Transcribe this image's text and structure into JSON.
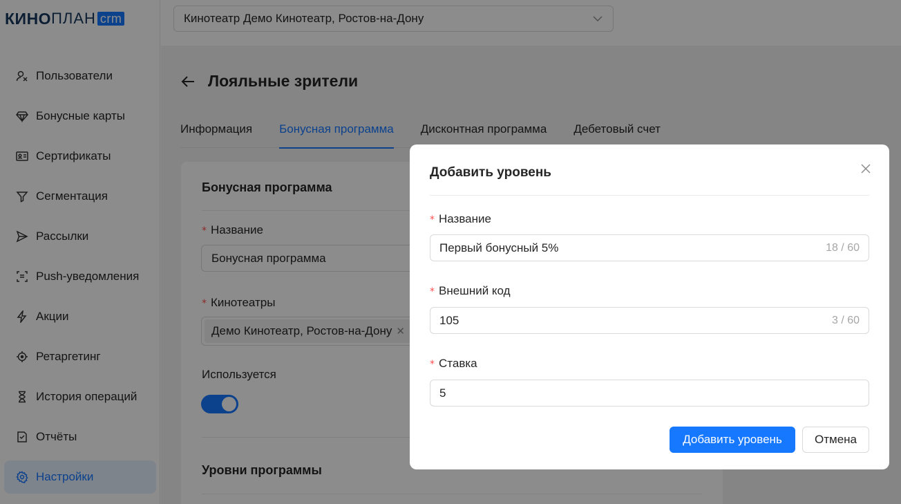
{
  "logo": {
    "main": "КИНО",
    "sub": "ПЛАН",
    "badge": "crm"
  },
  "sidebar": {
    "items": [
      {
        "label": "Пользователи",
        "icon": "users-icon"
      },
      {
        "label": "Бонусные карты",
        "icon": "diamond-icon"
      },
      {
        "label": "Сертификаты",
        "icon": "id-card-icon"
      },
      {
        "label": "Сегментация",
        "icon": "filter-icon"
      },
      {
        "label": "Рассылки",
        "icon": "send-icon"
      },
      {
        "label": "Push-уведомления",
        "icon": "push-icon"
      },
      {
        "label": "Акции",
        "icon": "lightning-icon"
      },
      {
        "label": "Ретаргетинг",
        "icon": "target-icon"
      },
      {
        "label": "История операций",
        "icon": "hourglass-icon"
      },
      {
        "label": "Отчёты",
        "icon": "report-icon"
      },
      {
        "label": "Настройки",
        "icon": "gear-icon",
        "active": true
      }
    ]
  },
  "header": {
    "cinema_select": "Кинотеатр Демо Кинотеатр, Ростов-на-Дону"
  },
  "page": {
    "title": "Лояльные зрители",
    "tabs": [
      {
        "label": "Информация"
      },
      {
        "label": "Бонусная программа",
        "active": true
      },
      {
        "label": "Дисконтная программа"
      },
      {
        "label": "Дебетовый счет"
      }
    ]
  },
  "card": {
    "title": "Бонусная программа",
    "name_label": "Название",
    "name_value": "Бонусная программа",
    "cinemas_label": "Кинотеатры",
    "cinema_tag": "Демо Кинотеатр, Ростов-на-Дону",
    "used_label": "Используется",
    "used_on": true,
    "levels_title": "Уровни программы"
  },
  "modal": {
    "title": "Добавить уровень",
    "required_mark": "*",
    "fields": [
      {
        "label": "Название",
        "value": "Первый бонусный 5%",
        "counter": "18 / 60"
      },
      {
        "label": "Внешний код",
        "value": "105",
        "counter": "3 / 60"
      },
      {
        "label": "Ставка",
        "value": "5"
      }
    ],
    "primary_button": "Добавить уровень",
    "cancel_button": "Отмена"
  },
  "colors": {
    "accent": "#1677ff",
    "required": "#ff4d4f",
    "overlay": "rgba(0,0,0,0.45)"
  }
}
